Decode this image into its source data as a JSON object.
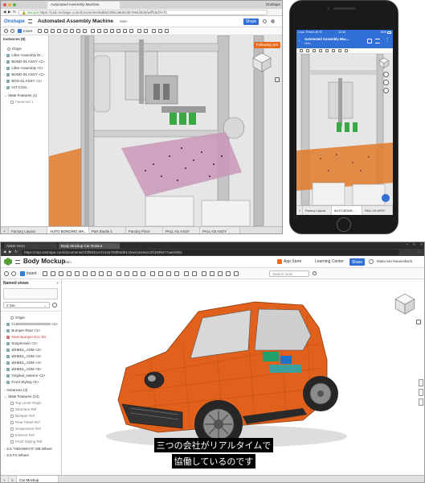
{
  "top_desktop": {
    "browser_tab_title": "Automated Assembly Machine",
    "browser_mac_label": "Onshape",
    "url_secure": "Secure",
    "url": "https://cad.onshape.com/documents/5ab0430bca8d4c0b79943928/w/ffc5d7e71",
    "brand": "Onshape",
    "doc_title": "Automated Assembly Machine",
    "doc_branch": "Main",
    "share_label": "Share",
    "insert_label": "Insert",
    "panel_header": "Instances (8)",
    "tree": [
      "Origin",
      "Lifter Assembly Dr...",
      "BOND-01 ASSY <1>",
      "Lifter Assembly <1>",
      "BOND-01 ASSY <1>",
      "BOX-01 ASSY <1>",
      "HIT CON...",
      "Mate Features (1)",
      "Fastened 1"
    ],
    "following_badge": "Following Jes",
    "tabs": [
      "Factory Layout",
      "AUTO BONDING MA...",
      "Part Studio 1",
      "Factory Floor",
      "PALL-01 ASSY",
      "PALL-03 ASSY"
    ]
  },
  "phone": {
    "carrier": "•••oo Three UK ✆",
    "time": "11:40",
    "battery": "36%",
    "doc_title": "Automated Assembly Mac...",
    "doc_branch": "Main",
    "tabs": [
      "Factory Layout",
      "AUTO BOND...",
      "PALL-04 ASSY"
    ]
  },
  "bottom_desktop": {
    "browser_tab_1": "Anker Hero",
    "browser_tab_2": "Body Mockup Car Rollout",
    "url": "https://cad.onshape.com/documents/1f3f9d31e1f1e2a7b8f93d81c0/w/2a4e5e12f1b5f8d77aa/e/8b2",
    "doc_title": "Body Mockup",
    "doc_branch": "Main",
    "app_store": "App Store",
    "learning_center": "Learning Center",
    "share_label": "Share",
    "user": "Maria van Hausenbach",
    "insert_label": "Insert",
    "search_tools": "Search tools",
    "panel_header": "Named views",
    "view_select": "2 Sec",
    "tree": [
      "Origin",
      "CUSSSSSSSSSSSSSS <1>",
      "Bumper Rear <1>",
      "Rear Bumper Ext. Str.",
      "Suspension <1>",
      "WHEEL_ASM <2>",
      "WHEEL_ASM <3>",
      "WHEEL_ASM <4>",
      "WHEEL_ASM <5>",
      "Original_exterior <1>",
      "Front Styling <1>",
      "Instances (3)",
      "Mate Features (14)",
      "Top Level Origin",
      "Structure Ref",
      "Bumper Ref",
      "Rear Panel Ref",
      "Suspension Ref",
      "Exterior Ref",
      "Front Styling Ref",
      "5.6 \"HIGHWAYS\" DB Wheel",
      "5.6 FS Wheel"
    ],
    "subtitle_line1": "三つの会社がリアルタイムで",
    "subtitle_line2": "協働しているのです",
    "tabs": [
      "Car Mockup"
    ]
  }
}
